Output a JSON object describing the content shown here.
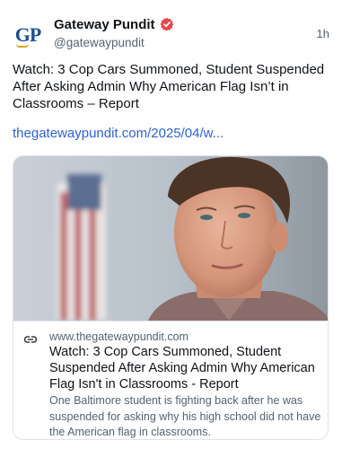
{
  "author": {
    "name": "Gateway Pundit",
    "handle": "@gatewaypundit",
    "avatar_text": "GP",
    "verified_icon": "verified-badge-icon",
    "verified_color": "#e8464d"
  },
  "timestamp": "1h",
  "post": {
    "text": "Watch: 3 Cop Cars Summoned, Student Suspended After Asking Admin Why American Flag Isn’t in Classrooms – Report",
    "link_text": "thegatewaypundit.com/2025/04/w..."
  },
  "card": {
    "domain": "www.thegatewaypundit.com",
    "title": "Watch: 3 Cop Cars Summoned, Student Suspended After Asking Admin Why American Flag Isn't in Classrooms - Report",
    "description": "One Baltimore student is fighting back after he was suspended for asking why his high school did not have the American flag in classrooms.",
    "link_icon": "link-icon"
  },
  "colors": {
    "link": "#2f61d1",
    "secondary_text": "#536471",
    "brand_blue": "#1d4f91"
  }
}
